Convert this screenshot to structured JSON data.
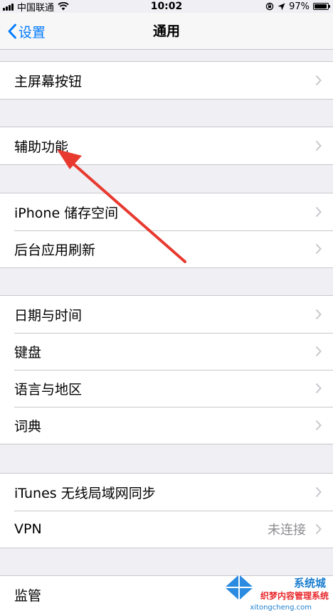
{
  "status_bar": {
    "carrier": "中国联通",
    "time": "10:02",
    "battery": "97%",
    "battery_level": 0.97,
    "icons": [
      "signal-icon",
      "wifi-icon",
      "orientation-lock-icon",
      "location-icon",
      "battery-icon"
    ]
  },
  "nav": {
    "back_label": "设置",
    "title": "通用"
  },
  "groups": [
    {
      "rows": [
        {
          "label": "主屏幕按钮"
        }
      ]
    },
    {
      "rows": [
        {
          "label": "辅助功能"
        }
      ]
    },
    {
      "rows": [
        {
          "label": "iPhone 储存空间"
        },
        {
          "label": "后台应用刷新"
        }
      ]
    },
    {
      "rows": [
        {
          "label": "日期与时间"
        },
        {
          "label": "键盘"
        },
        {
          "label": "语言与地区"
        },
        {
          "label": "词典"
        }
      ]
    },
    {
      "rows": [
        {
          "label": "iTunes 无线局域网同步"
        },
        {
          "label": "VPN",
          "value": "未连接"
        }
      ]
    },
    {
      "rows": [
        {
          "label": "监管"
        }
      ]
    }
  ],
  "annotation": {
    "color": "#e8392f"
  },
  "watermark": {
    "line1": "系统城",
    "line2": "织梦内容管理系统",
    "line3": "xitongcheng.com"
  },
  "colors": {
    "accent": "#007aff",
    "background": "#efeff4"
  }
}
